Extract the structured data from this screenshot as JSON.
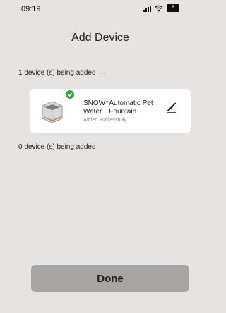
{
  "status_bar": {
    "time": "09:19",
    "battery": "8"
  },
  "header": {
    "title": "Add Device"
  },
  "added_section": {
    "label": "1 device (s) being added"
  },
  "device": {
    "name": "SNOW⁺Automatic Pet Water Fountain",
    "status": "Added Successfully",
    "status_color": "#2ea043",
    "icon": "pet-water-fountain"
  },
  "pending_section": {
    "label": "0 device (s) being added"
  },
  "footer": {
    "done_label": "Done"
  }
}
